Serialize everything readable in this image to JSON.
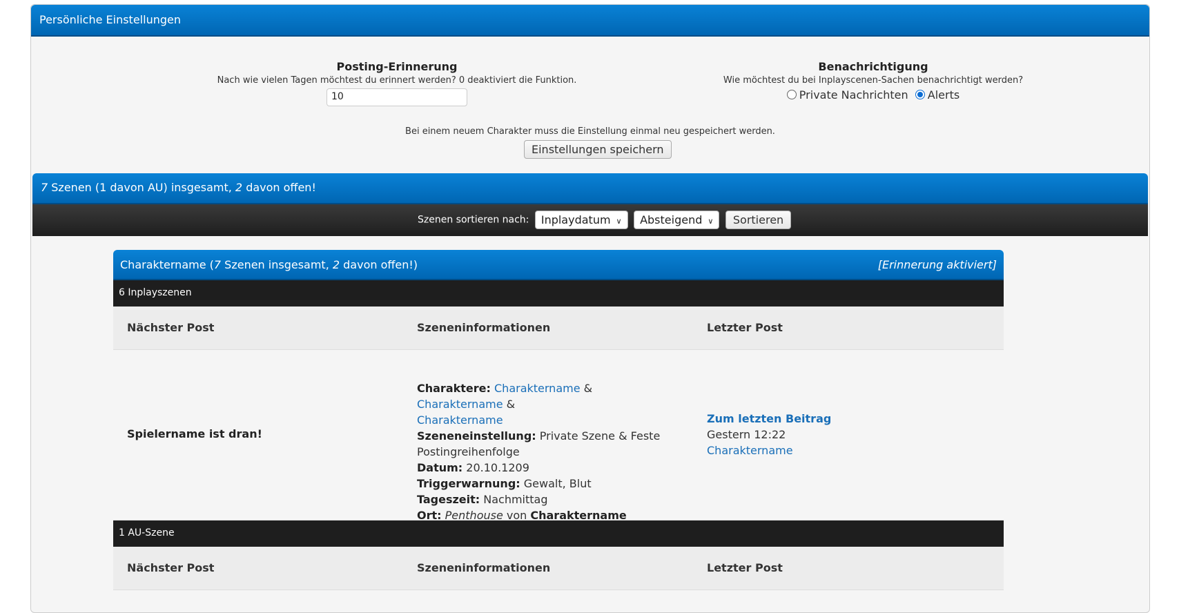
{
  "settings_header": "Persönliche Einstellungen",
  "posting": {
    "title": "Posting-Erinnerung",
    "desc": "Nach wie vielen Tagen möchtest du erinnert werden? 0 deaktiviert die Funktion.",
    "value": "10"
  },
  "notify": {
    "title": "Benachrichtigung",
    "desc": "Wie möchtest du bei Inplayscenen-Sachen benachrichtigt werden?",
    "options": [
      "Private Nachrichten",
      "Alerts"
    ],
    "selected": "Alerts"
  },
  "note": "Bei einem neuem Charakter muss die Einstellung einmal neu gespeichert werden.",
  "save_label": "Einstellungen speichern",
  "summary": {
    "total": "7",
    "text1": " Szenen (1 davon AU) insgesamt, ",
    "open": "2",
    "text2": " davon offen!"
  },
  "sort": {
    "label": "Szenen sortieren nach:",
    "field": "Inplaydatum",
    "order": "Absteigend",
    "button": "Sortieren"
  },
  "character": {
    "name": "Charaktername",
    "p1": " (",
    "total": "7",
    "p2": " Szenen insgesamt, ",
    "open": "2",
    "p3": " davon offen!)",
    "reminder": "[Erinnerung aktiviert]"
  },
  "inplay_header": "6 Inplayszenen",
  "au_header": "1 AU-Szene",
  "columns": [
    "Nächster Post",
    "Szeneninformationen",
    "Letzter Post"
  ],
  "scene": {
    "next": "Spielername ist dran!",
    "chars_label": "Charaktere:",
    "char1": "Charaktername",
    "amp": " & ",
    "char2": "Charaktername",
    "char3": "Charaktername",
    "setting_label": "Szeneneinstellung:",
    "setting": " Private Szene & Feste Postingreihenfolge",
    "date_label": "Datum:",
    "date": " 20.10.1209",
    "trigger_label": "Triggerwarnung:",
    "trigger": " Gewalt, Blut",
    "time_label": "Tageszeit:",
    "time": " Nachmittag",
    "place_label": "Ort:",
    "place": "Penthouse",
    "place_von": " von ",
    "place_owner": "Charaktername",
    "last_link": "Zum letzten Beitrag",
    "last_time": "Gestern 12:22",
    "last_author": "Charaktername"
  },
  "colors": {
    "blue": "#0a82d6",
    "dark": "#1e1e1e",
    "link": "#1a6fb8"
  }
}
